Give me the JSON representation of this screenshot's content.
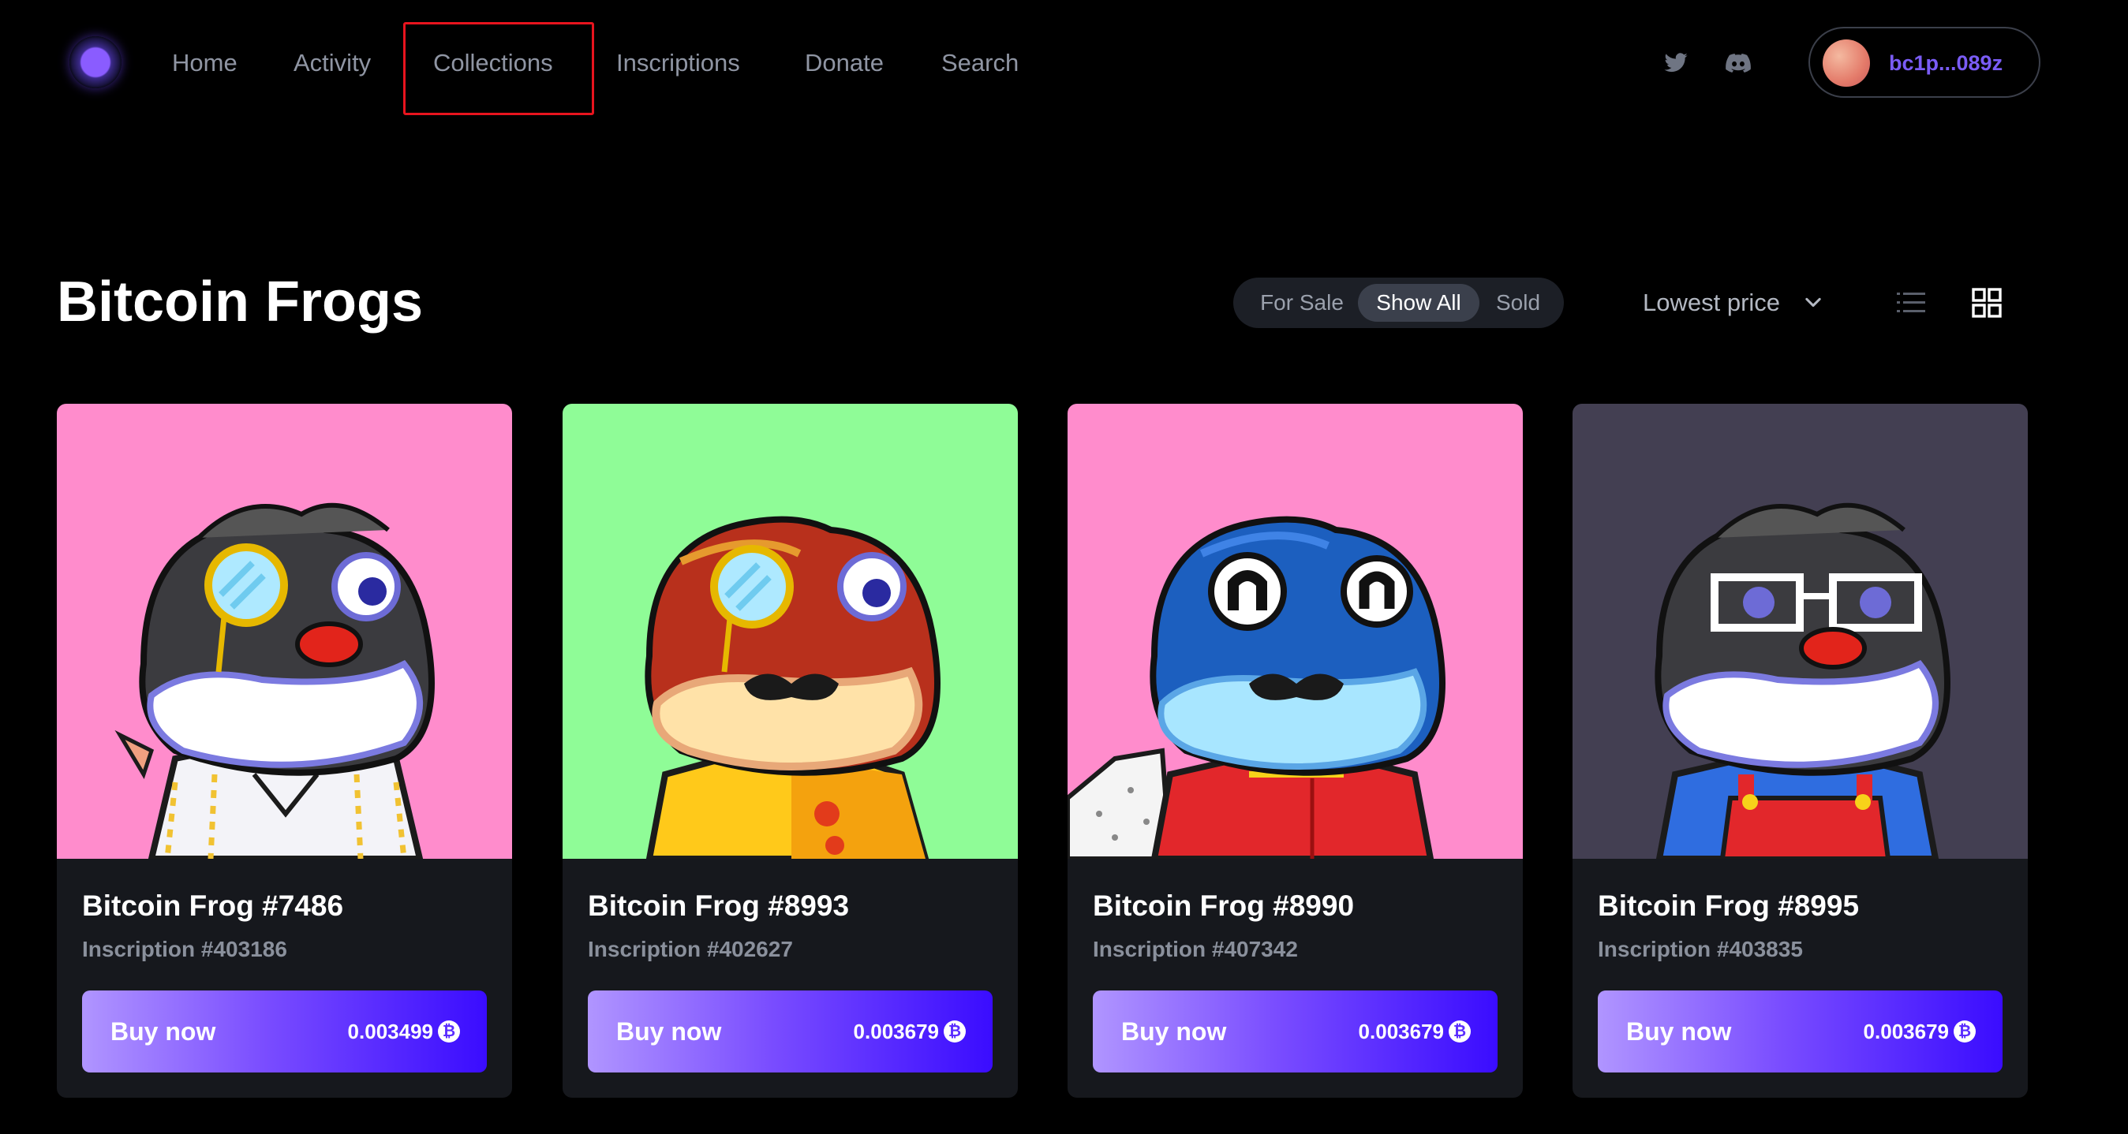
{
  "nav": {
    "links": [
      "Home",
      "Activity",
      "Collections",
      "Inscriptions",
      "Donate",
      "Search"
    ],
    "wallet_address": "bc1p...089z"
  },
  "collection": {
    "title": "Bitcoin Frogs",
    "filters": [
      "For Sale",
      "Show All",
      "Sold"
    ],
    "active_filter": "Show All",
    "sort_label": "Lowest price"
  },
  "colors": {
    "accent": "#7a5cf5",
    "buy_gradient_start": "#b095ff",
    "buy_gradient_end": "#3a0cff",
    "highlight_box": "#e8141e"
  },
  "items": [
    {
      "name": "Bitcoin Frog #7486",
      "inscription": "Inscription #403186",
      "buy_label": "Buy now",
      "price": "0.003499",
      "bg": "#ff8ccc"
    },
    {
      "name": "Bitcoin Frog #8993",
      "inscription": "Inscription #402627",
      "buy_label": "Buy now",
      "price": "0.003679",
      "bg": "#8ffc97"
    },
    {
      "name": "Bitcoin Frog #8990",
      "inscription": "Inscription #407342",
      "buy_label": "Buy now",
      "price": "0.003679",
      "bg": "#ff8ccc"
    },
    {
      "name": "Bitcoin Frog #8995",
      "inscription": "Inscription #403835",
      "buy_label": "Buy now",
      "price": "0.003679",
      "bg": "#433f52"
    }
  ]
}
